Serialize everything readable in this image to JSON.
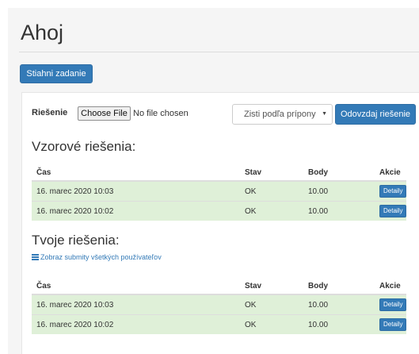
{
  "page": {
    "title": "Ahoj",
    "download_task_label": "Stiahni zadanie"
  },
  "form": {
    "solution_label": "Riešenie",
    "file_button_label": "Choose File",
    "file_status": "No file chosen",
    "extension_select_value": "Zisti podľa prípony",
    "submit_label": "Odovzdaj riešenie"
  },
  "example_solutions": {
    "heading": "Vzorové riešenia:",
    "columns": [
      "Čas",
      "Stav",
      "Body",
      "Akcie"
    ],
    "rows": [
      {
        "time": "16. marec 2020 10:03",
        "status": "OK",
        "points": "10.00",
        "action": "Detaily"
      },
      {
        "time": "16. marec 2020 10:02",
        "status": "OK",
        "points": "10.00",
        "action": "Detaily"
      }
    ]
  },
  "your_solutions": {
    "heading": "Tvoje riešenia:",
    "all_users_link": "Zobraz submity všetkých používateľov",
    "columns": [
      "Čas",
      "Stav",
      "Body",
      "Akcie"
    ],
    "rows": [
      {
        "time": "16. marec 2020 10:03",
        "status": "OK",
        "points": "10.00",
        "action": "Detaily"
      },
      {
        "time": "16. marec 2020 10:02",
        "status": "OK",
        "points": "10.00",
        "action": "Detaily"
      }
    ]
  },
  "colors": {
    "primary": "#337ab7",
    "success_row": "#dff0d8",
    "page_background": "#f5f5f5"
  }
}
